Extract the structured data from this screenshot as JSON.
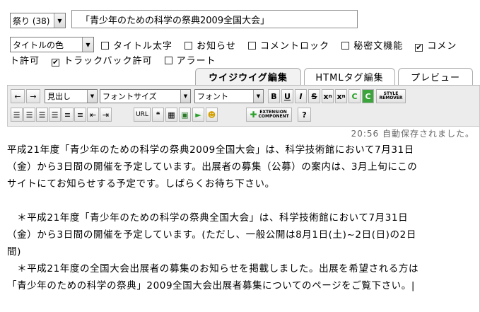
{
  "category": {
    "selected": "祭り (38)"
  },
  "title_value": "「青少年のための科学の祭典2009全国大会」",
  "title_color_select": "タイトルの色",
  "options": [
    {
      "label": "タイトル太字",
      "checked": false
    },
    {
      "label": "お知らせ",
      "checked": false
    },
    {
      "label": "コメントロック",
      "checked": false
    },
    {
      "label": "秘密文機能",
      "checked": false
    },
    {
      "label": "コメン",
      "checked": true
    }
  ],
  "options_line2": {
    "comment_allow_rest": "ト許可",
    "trackback_label": "トラックバック許可",
    "trackback_checked": true,
    "alert_label": "アラート",
    "alert_checked": false
  },
  "tabs": [
    "ウイジウイグ編集",
    "HTMLタグ編集",
    "プレビュー"
  ],
  "toolbar": {
    "undo": "←",
    "redo": "→",
    "heading_select": "見出し",
    "fontsize_select": "フォントサイズ",
    "font_select": "フォント",
    "bold": "B",
    "underline": "U",
    "italic": "I",
    "strike": "S",
    "superscript": "x",
    "subscript": "x",
    "color_text": "C",
    "color_bg": "C",
    "style_remover": "STYLE REMOVER",
    "url": "URL",
    "quote": "❝",
    "extension": "EXTENSION COMPONENT",
    "help": "?"
  },
  "autosave_text": "20:56 自動保存されました。",
  "editor_lines": [
    "平成21年度「青少年のための科学の祭典2009全国大会」は、科学技術館において7月31日",
    "（金）から3日間の開催を予定しています。出展者の募集（公募）の案内は、3月上旬にこの",
    "サイトにてお知らせする予定です。しばらくお待ち下さい。",
    "",
    "　＊平成21年度「青少年のための科学の祭典全国大会」は、科学技術館において7月31日",
    "（金）から3日間の開催を予定しています。(ただし、一般公開は8月1日(土)~2日(日)の2日",
    "間)",
    "　＊平成21年度の全国大会出展者の募集のお知らせを掲載しました。出展を希望される方は",
    "「青少年のための科学の祭典」2009全国大会出展者募集についてのページをご覧下さい。|"
  ]
}
